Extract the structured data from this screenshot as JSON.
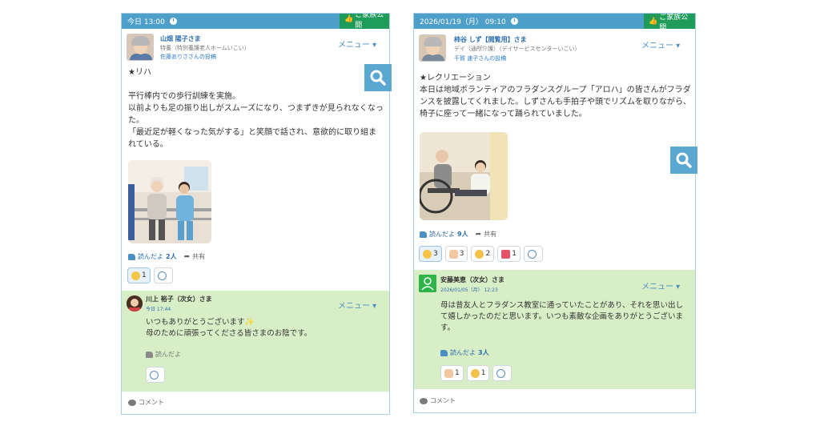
{
  "posts": [
    {
      "header_time": "今日 13:00",
      "public_label": "ご家族公開",
      "author_name": "山畑 陽子さま",
      "author_facility": "特養（特別養護老人ホームいこい）",
      "posted_by": "佐藤ありささんの投稿",
      "menu_label": "メニュー ▾",
      "text": "★リハ\n\n平行棒内での歩行訓練を実施。\n以前よりも足の振り出しがスムーズになり、つまずきが見られなくなった。\n「最近足が軽くなった気がする」と笑顔で話され、意欲的に取り組まれている。",
      "reads_label": "読んだよ",
      "reads_count": "2人",
      "share_label": "共有",
      "reactions": [
        {
          "emoji": "smile",
          "count": "1"
        }
      ],
      "comment": {
        "name": "川上 裕子（次女）さま",
        "time": "今日 17:44",
        "menu_label": "メニュー ▾",
        "text": "いつもありがとうございます✨\n母のために頑張ってくださる皆さまのお陰です。",
        "reads_label": "読んだよ"
      },
      "footer_label": "コメント"
    },
    {
      "header_time": "2026/01/19（月） 09:10",
      "public_label": "ご家族公開",
      "author_name": "柿谷 しず【閲覧用】さま",
      "author_facility": "デイ（通所介護）（デイサービスセンターいこい）",
      "posted_by": "千賀 速子さんの投稿",
      "menu_label": "メニュー ▾",
      "text": "★レクリエーション\n本日は地域ボランティアのフラダンスグループ「アロハ」の皆さんがフラダンスを披露してくれました。しずさんも手拍子や頭でリズムを取りながら、椅子に座って一緒になって踊られていました。",
      "reads_label": "読んだよ",
      "reads_count": "9人",
      "share_label": "共有",
      "reactions": [
        {
          "emoji": "smile",
          "count": "3"
        },
        {
          "emoji": "thumbs",
          "count": "3"
        },
        {
          "emoji": "heart",
          "count": "2"
        },
        {
          "emoji": "party",
          "count": "1"
        }
      ],
      "comment": {
        "name": "安藤美恵（次女）さま",
        "time": "2026/01/05（月） 12:23",
        "menu_label": "メニュー ▾",
        "text": "母は昔友人とフラダンス教室に通っていたことがあり、それを思い出して嬉しかったのだと思います。いつも素敵な企画をありがとうございます。",
        "reads_label": "読んだよ",
        "reads_count": "3人",
        "reactions": [
          {
            "emoji": "thumbs",
            "count": "1"
          },
          {
            "emoji": "heart",
            "count": "1"
          }
        ]
      },
      "footer_label": "コメント"
    }
  ],
  "icons": {
    "search": "search-icon",
    "clock": "clock-icon",
    "thumb": "thumbs-up-icon",
    "share": "share-arrow-icon",
    "add_reaction": "add-reaction-icon",
    "comment": "comment-bubble-icon"
  },
  "colors": {
    "header_blue": "#4e9fca",
    "public_green": "#1f9c5a",
    "comment_bg": "#d8eec6",
    "link_blue": "#2b6cb0",
    "search_bg": "#5aa7d2"
  }
}
